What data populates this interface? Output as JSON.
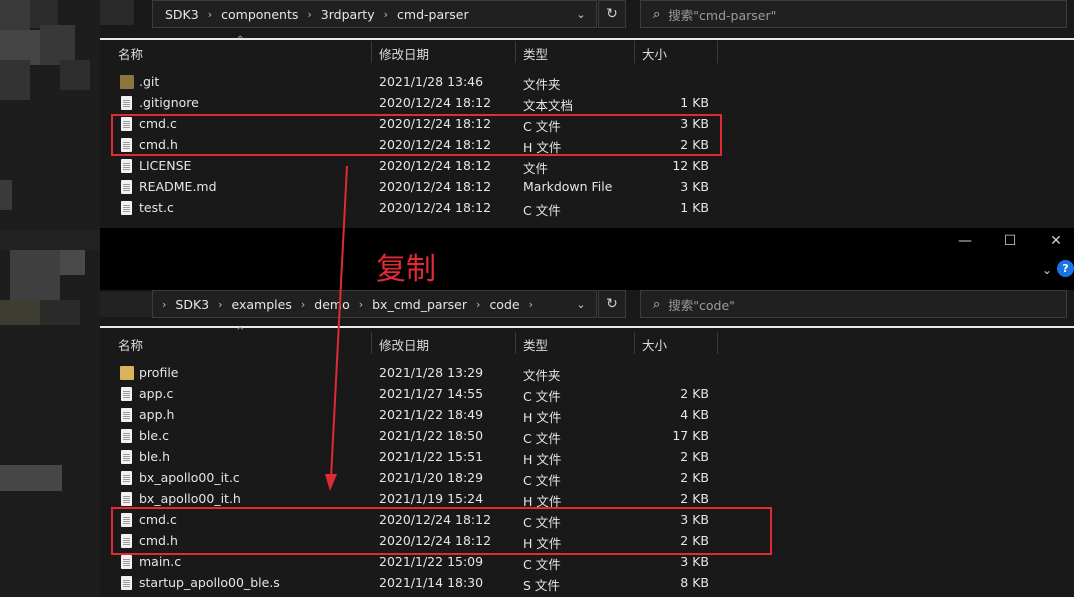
{
  "top": {
    "breadcrumb": [
      "SDK3",
      "components",
      "3rdparty",
      "cmd-parser"
    ],
    "search_placeholder": "搜索\"cmd-parser\"",
    "columns": {
      "name": "名称",
      "modified": "修改日期",
      "type": "类型",
      "size": "大小"
    },
    "files": [
      {
        "name": ".git",
        "date": "2021/1/28 13:46",
        "type": "文件夹",
        "size": "",
        "icon": "folder-icon"
      },
      {
        "name": ".gitignore",
        "date": "2020/12/24 18:12",
        "type": "文本文档",
        "size": "1 KB",
        "icon": "file-icon"
      },
      {
        "name": "cmd.c",
        "date": "2020/12/24 18:12",
        "type": "C 文件",
        "size": "3 KB",
        "icon": "file-icon"
      },
      {
        "name": "cmd.h",
        "date": "2020/12/24 18:12",
        "type": "H 文件",
        "size": "2 KB",
        "icon": "file-icon"
      },
      {
        "name": "LICENSE",
        "date": "2020/12/24 18:12",
        "type": "文件",
        "size": "12 KB",
        "icon": "file-icon"
      },
      {
        "name": "README.md",
        "date": "2020/12/24 18:12",
        "type": "Markdown File",
        "size": "3 KB",
        "icon": "markdown-file-icon"
      },
      {
        "name": "test.c",
        "date": "2020/12/24 18:12",
        "type": "C 文件",
        "size": "1 KB",
        "icon": "file-icon"
      }
    ]
  },
  "annotation": {
    "label": "复制",
    "color": "#e02b35"
  },
  "bottom": {
    "breadcrumb": [
      "SDK3",
      "examples",
      "demo",
      "bx_cmd_parser",
      "code"
    ],
    "search_placeholder": "搜索\"code\"",
    "columns": {
      "name": "名称",
      "modified": "修改日期",
      "type": "类型",
      "size": "大小"
    },
    "files": [
      {
        "name": "profile",
        "date": "2021/1/28 13:29",
        "type": "文件夹",
        "size": "",
        "icon": "folder-icon"
      },
      {
        "name": "app.c",
        "date": "2021/1/27 14:55",
        "type": "C 文件",
        "size": "2 KB",
        "icon": "file-icon"
      },
      {
        "name": "app.h",
        "date": "2021/1/22 18:49",
        "type": "H 文件",
        "size": "4 KB",
        "icon": "file-icon"
      },
      {
        "name": "ble.c",
        "date": "2021/1/22 18:50",
        "type": "C 文件",
        "size": "17 KB",
        "icon": "file-icon"
      },
      {
        "name": "ble.h",
        "date": "2021/1/22 15:51",
        "type": "H 文件",
        "size": "2 KB",
        "icon": "file-icon"
      },
      {
        "name": "bx_apollo00_it.c",
        "date": "2021/1/20 18:29",
        "type": "C 文件",
        "size": "2 KB",
        "icon": "file-icon"
      },
      {
        "name": "bx_apollo00_it.h",
        "date": "2021/1/19 15:24",
        "type": "H 文件",
        "size": "2 KB",
        "icon": "file-icon"
      },
      {
        "name": "cmd.c",
        "date": "2020/12/24 18:12",
        "type": "C 文件",
        "size": "3 KB",
        "icon": "file-icon"
      },
      {
        "name": "cmd.h",
        "date": "2020/12/24 18:12",
        "type": "H 文件",
        "size": "2 KB",
        "icon": "file-icon"
      },
      {
        "name": "main.c",
        "date": "2021/1/22 15:09",
        "type": "C 文件",
        "size": "3 KB",
        "icon": "file-icon"
      },
      {
        "name": "startup_apollo00_ble.s",
        "date": "2021/1/14 18:30",
        "type": "S 文件",
        "size": "8 KB",
        "icon": "file-icon"
      }
    ]
  },
  "colors": {
    "background": "#191919",
    "highlight": "#e02b35",
    "folder": "#d8b45a",
    "git_folder": "#8e7540"
  }
}
